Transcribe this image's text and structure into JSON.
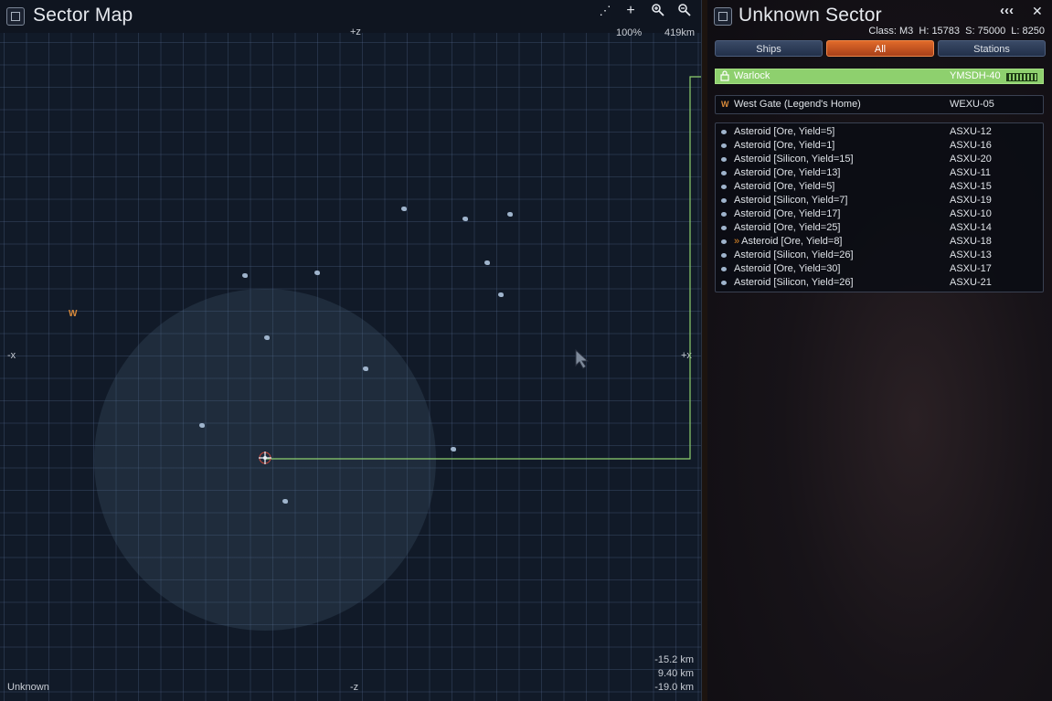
{
  "map": {
    "title": "Sector Map",
    "axes": {
      "plus_z": "+z",
      "minus_z": "-z",
      "minus_x": "-x",
      "plus_x": "+x"
    },
    "zoom": "100%",
    "range": "419km",
    "coords": [
      "-15.2 km",
      "9.40 km",
      "-19.0 km"
    ],
    "sector_name": "Unknown",
    "gate_letter": "W",
    "toolbar": {
      "add": "+",
      "zoom_in": "⚲",
      "zoom_out": "⚲"
    }
  },
  "info": {
    "title": "Unknown Sector",
    "collapse": "‹‹‹",
    "close": "✕",
    "stats": "Class: M3  H: 15783  S: 75000  L: 8250",
    "tabs": [
      "Ships",
      "All",
      "Stations"
    ],
    "selected": {
      "name": "Warlock",
      "code": "YMSDH-40"
    },
    "gates": [
      {
        "icon": "W",
        "name": "West Gate (Legend's Home)",
        "code": "WEXU-05"
      }
    ],
    "asteroids": [
      {
        "name": "Asteroid [Ore, Yield=5]",
        "code": "ASXU-12",
        "target": false
      },
      {
        "name": "Asteroid [Ore, Yield=1]",
        "code": "ASXU-16",
        "target": false
      },
      {
        "name": "Asteroid [Silicon, Yield=15]",
        "code": "ASXU-20",
        "target": false
      },
      {
        "name": "Asteroid [Ore, Yield=13]",
        "code": "ASXU-11",
        "target": false
      },
      {
        "name": "Asteroid [Ore, Yield=5]",
        "code": "ASXU-15",
        "target": false
      },
      {
        "name": "Asteroid [Silicon, Yield=7]",
        "code": "ASXU-19",
        "target": false
      },
      {
        "name": "Asteroid [Ore, Yield=17]",
        "code": "ASXU-10",
        "target": false
      },
      {
        "name": "Asteroid [Ore, Yield=25]",
        "code": "ASXU-14",
        "target": false
      },
      {
        "name": "Asteroid [Ore, Yield=8]",
        "code": "ASXU-18",
        "target": true,
        "target_mark": "»"
      },
      {
        "name": "Asteroid [Silicon, Yield=26]",
        "code": "ASXU-13",
        "target": false
      },
      {
        "name": "Asteroid [Ore, Yield=30]",
        "code": "ASXU-17",
        "target": false
      },
      {
        "name": "Asteroid [Silicon, Yield=26]",
        "code": "ASXU-21",
        "target": false
      }
    ]
  },
  "colors": {
    "accent": "#e06a2a",
    "selection": "#8ed06e",
    "route": "#8ed06e",
    "gate": "#d98a3a"
  }
}
